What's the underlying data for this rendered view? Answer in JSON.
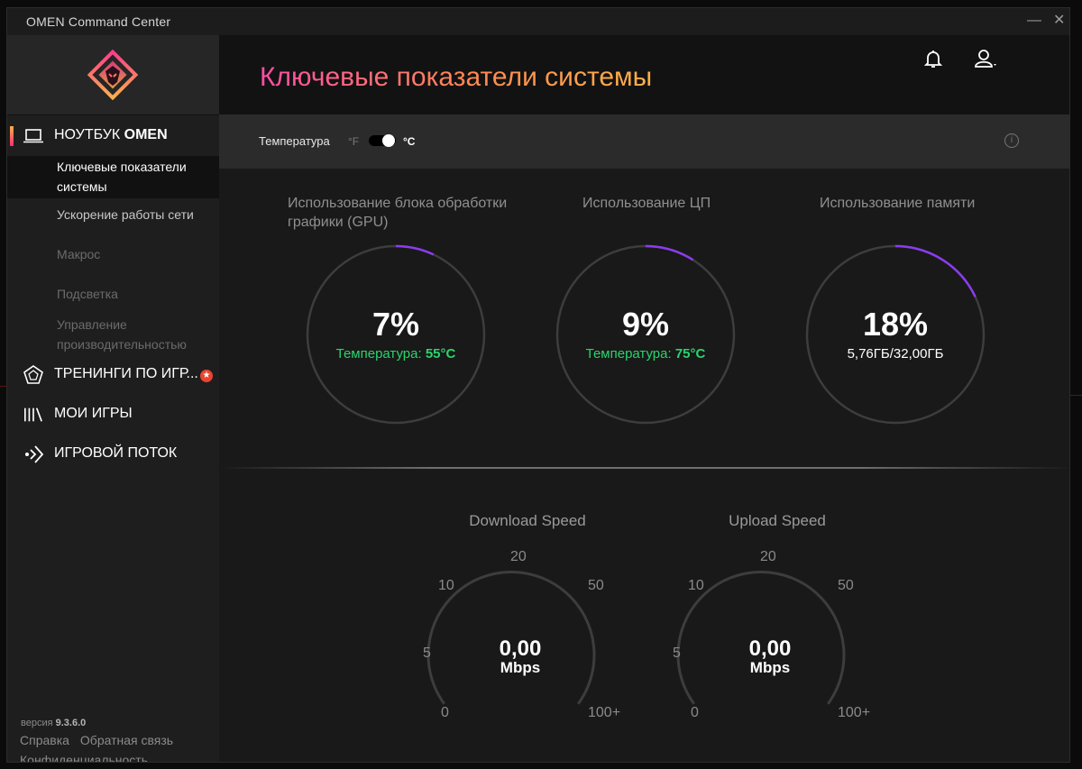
{
  "window": {
    "title": "OMEN Command Center",
    "min_glyph": "—",
    "close_glyph": "✕"
  },
  "sidebar": {
    "device": {
      "label_prefix": "НОУТБУК ",
      "label_bold": "OMEN",
      "icon": "laptop-icon"
    },
    "sub_items": [
      {
        "label": "Ключевые показатели системы",
        "state": "selected"
      },
      {
        "label": "Ускорение работы сети",
        "state": "enabled"
      },
      {
        "label": "Макрос",
        "state": "disabled"
      },
      {
        "label": "Подсветка",
        "state": "disabled"
      },
      {
        "label": "Управление производительностью",
        "state": "disabled"
      }
    ],
    "sections": [
      {
        "label": "ТРЕНИНГИ ПО ИГР...",
        "icon": "badge-trophy-icon",
        "badge": "★"
      },
      {
        "label": "МОИ ИГРЫ",
        "icon": "library-icon"
      },
      {
        "label": "ИГРОВОЙ ПОТОК",
        "icon": "stream-icon"
      }
    ],
    "footer": {
      "version_label": "версия",
      "version": "9.3.6.0",
      "links": [
        "Справка",
        "Обратная связь",
        "Конфиденциальность"
      ]
    }
  },
  "header": {
    "title": "Ключевые показатели системы",
    "icons": [
      "bell-icon",
      "user-menu-icon"
    ]
  },
  "temperature": {
    "label": "Температура",
    "unit_f": "°F",
    "unit_c": "°C",
    "selected_unit": "C"
  },
  "gauges": [
    {
      "title": "Использование блока обработки графики (GPU)",
      "value": "7%",
      "fraction": 0.07,
      "temp_label": "Температура:",
      "temp_value": "55°C"
    },
    {
      "title": "Использование ЦП",
      "value": "9%",
      "fraction": 0.09,
      "temp_label": "Температура:",
      "temp_value": "75°C"
    },
    {
      "title": "Использование памяти",
      "value": "18%",
      "fraction": 0.18,
      "detail": "5,76ГБ/32,00ГБ"
    }
  ],
  "speed": [
    {
      "title": "Download Speed",
      "value": "0,00",
      "unit": "Mbps",
      "ticks": [
        "0",
        "5",
        "10",
        "20",
        "50",
        "100+"
      ]
    },
    {
      "title": "Upload Speed",
      "value": "0,00",
      "unit": "Mbps",
      "ticks": [
        "0",
        "5",
        "10",
        "20",
        "50",
        "100+"
      ]
    }
  ],
  "colors": {
    "accent_start": "#ff4da6",
    "accent_end": "#ffb14a",
    "gauge_arc": "#8b3cf0",
    "temp_green": "#2ad46c"
  }
}
